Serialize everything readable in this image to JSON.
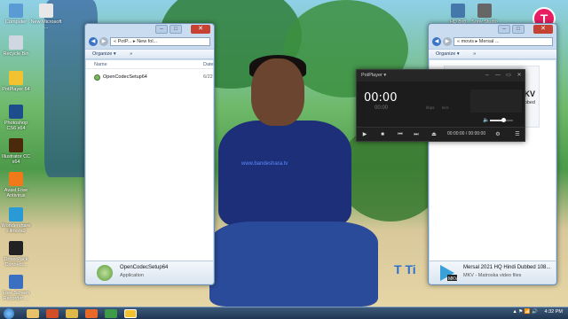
{
  "desktop_icons": [
    {
      "label": "Computer",
      "color": "#5b9bd5"
    },
    {
      "label": "New Microsoft ...",
      "color": "#e8e8e8"
    },
    {
      "label": "Recycle Bin",
      "color": "#cfd8e0"
    },
    {
      "label": "PotPlayer 64",
      "color": "#f2c230"
    },
    {
      "label": "Photoshop CS6 x64",
      "color": "#1e4d8c"
    },
    {
      "label": "Illustrator CC x64",
      "color": "#4a2a0a"
    },
    {
      "label": "Avast Free Antivirus",
      "color": "#f07a1a"
    },
    {
      "label": "Wondershare Filmora9",
      "color": "#2a9ad6"
    },
    {
      "label": "DriverPack Connect...",
      "color": "#222222"
    },
    {
      "label": "Free Screen Recorder ...",
      "color": "#3a6fc2"
    }
  ],
  "right_desktop_icons": [
    {
      "label": "HD 8x8",
      "color": "#4477aa"
    },
    {
      "label": "Sony Studio",
      "color": "#666666"
    }
  ],
  "window_left": {
    "address": "« PotP... ▸ New fol...",
    "organize": "Organize ▾",
    "more": "»",
    "col_name": "Name",
    "col_date": "Date",
    "file_name": "OpenCodecSetup64",
    "file_date": "6/22",
    "details_name": "OpenCodecSetup64",
    "details_type": "Application"
  },
  "window_right": {
    "address": "« movis ▸ Mersal ...",
    "organize": "Organize ▾",
    "more": "»",
    "thumb_label": "MKV",
    "thumb_sub": "Dubbed",
    "details_name": "Mersal 2021 HQ Hindi Dubbed 108...",
    "details_type": "MKV - Matroska video files"
  },
  "potplayer": {
    "title": "PotPlayer ▾",
    "time_big": "00:00",
    "time_small": "00:00",
    "kbps1": "kbps",
    "kbps2": "kHz",
    "position": "00:00:00",
    "separator": "/",
    "duration": "00:00:00",
    "play_icon": "▶",
    "stop_icon": "■",
    "prev_icon": "⏮",
    "next_icon": "⏭",
    "eject_icon": "⏏",
    "menu_icon": "☰",
    "gear_icon": "⚙",
    "speaker_icon": "🔈",
    "pin_icon": "⇔",
    "min_icon": "—",
    "max_icon": "▭",
    "close_icon": "✕",
    "volume_fraction": 0.6
  },
  "wallpaper": {
    "shirt_text": "www.bandeshara.tv",
    "brand": "T Ti",
    "channel_logo": "T"
  },
  "taskbar": {
    "clock": "4:32 PM",
    "tray_icons": "▲ ⚑ 📶 🔊"
  }
}
